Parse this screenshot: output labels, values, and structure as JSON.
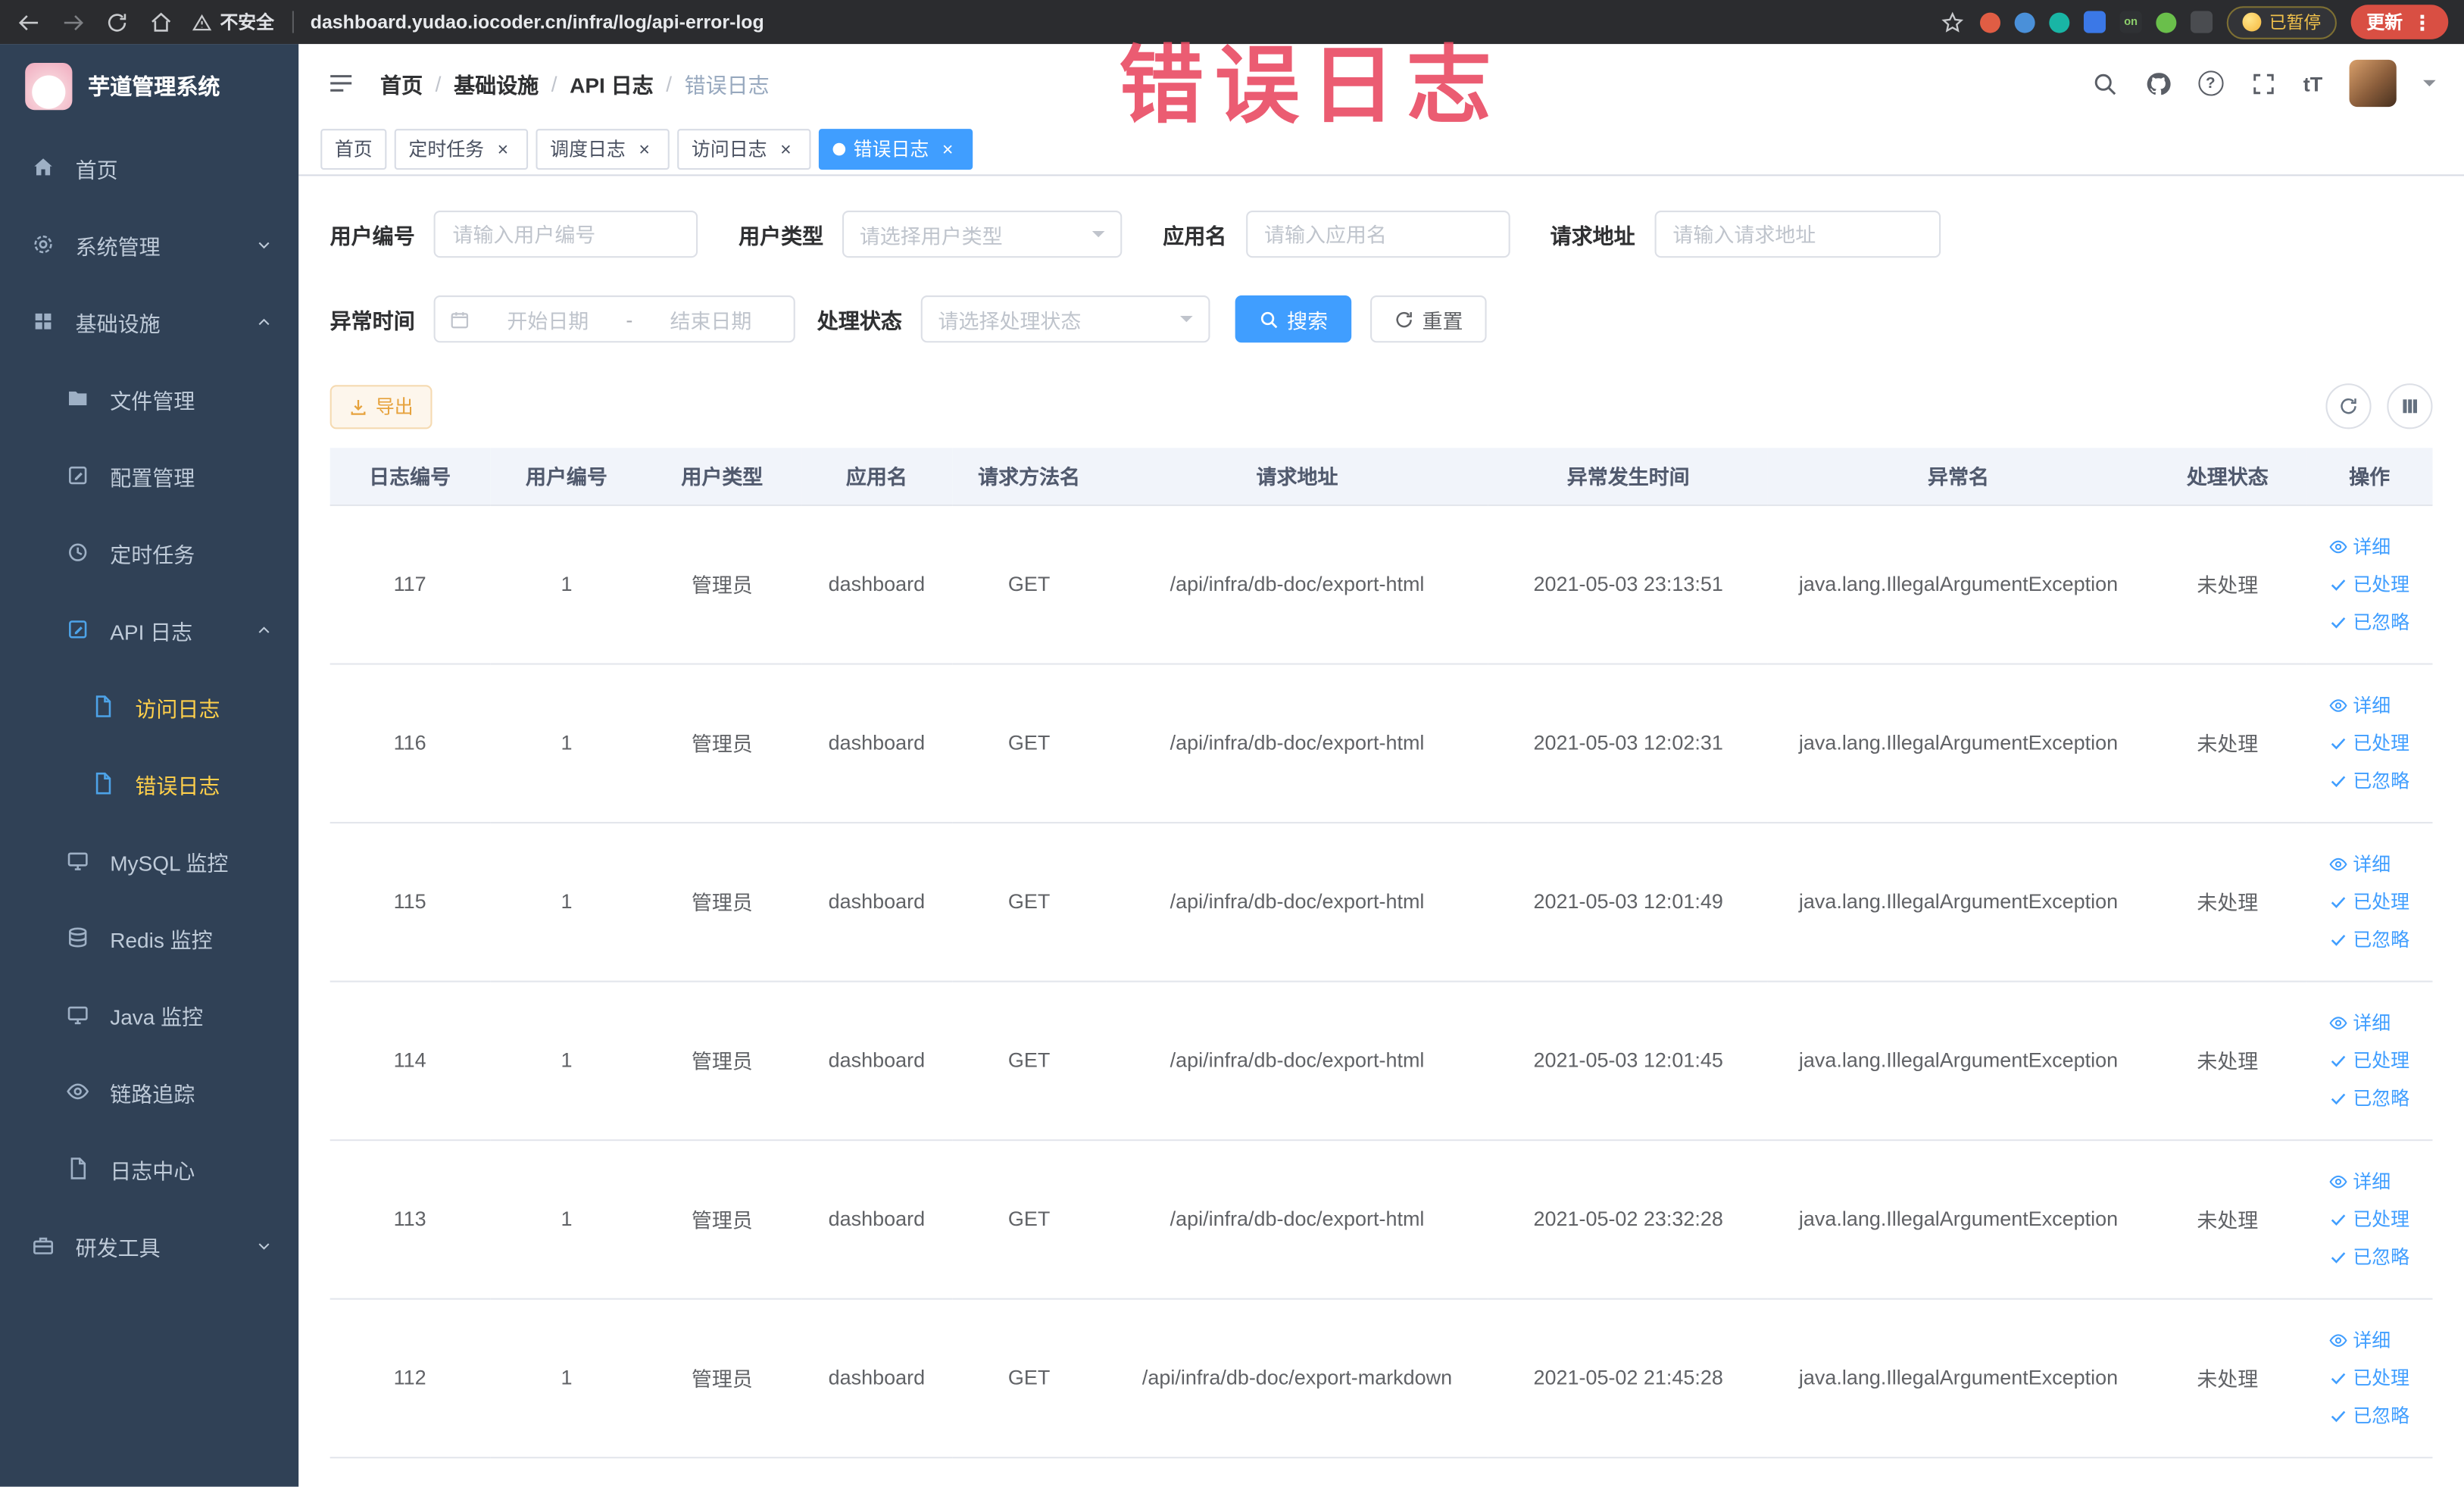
{
  "browser": {
    "security_label": "不安全",
    "url": "dashboard.yudao.iocoder.cn/infra/log/api-error-log",
    "extension_on_label": "on",
    "paused_badge": "已暂停",
    "update_label": "更新"
  },
  "annotation": {
    "text": "错误日志"
  },
  "sidebar": {
    "logo_title": "芋道管理系统",
    "home": "首页",
    "system": "系统管理",
    "infra": "基础设施",
    "devtools": "研发工具",
    "infra_items": [
      "文件管理",
      "配置管理",
      "定时任务",
      "API 日志",
      "MySQL 监控",
      "Redis 监控",
      "Java 监控",
      "链路追踪",
      "日志中心"
    ],
    "api_items": [
      "访问日志",
      "错误日志"
    ]
  },
  "header": {
    "breadcrumb": [
      "首页",
      "基础设施",
      "API 日志",
      "错误日志"
    ],
    "help_label": "?",
    "font_size_label": "tT"
  },
  "tabs": {
    "items": [
      "首页",
      "定时任务",
      "调度日志",
      "访问日志",
      "错误日志"
    ]
  },
  "filters": {
    "user_id": {
      "label": "用户编号",
      "placeholder": "请输入用户编号"
    },
    "user_type": {
      "label": "用户类型",
      "placeholder": "请选择用户类型"
    },
    "app_name": {
      "label": "应用名",
      "placeholder": "请输入应用名"
    },
    "request_url": {
      "label": "请求地址",
      "placeholder": "请输入请求地址"
    },
    "exception_time": {
      "label": "异常时间",
      "start_placeholder": "开始日期",
      "separator": "-",
      "end_placeholder": "结束日期"
    },
    "process_status": {
      "label": "处理状态",
      "placeholder": "请选择处理状态"
    },
    "search_button": "搜索",
    "reset_button": "重置"
  },
  "toolbar": {
    "export_button": "导出"
  },
  "table": {
    "headers": [
      "日志编号",
      "用户编号",
      "用户类型",
      "应用名",
      "请求方法名",
      "请求地址",
      "异常发生时间",
      "异常名",
      "处理状态",
      "操作"
    ],
    "actions": {
      "detail": "详细",
      "processed": "已处理",
      "ignored": "已忽略"
    },
    "rows": [
      {
        "log_id": "117",
        "user_id": "1",
        "user_type": "管理员",
        "app_name": "dashboard",
        "method": "GET",
        "url": "/api/infra/db-doc/export-html",
        "time": "2021-05-03 23:13:51",
        "exception": "java.lang.IllegalArgumentException",
        "status": "未处理"
      },
      {
        "log_id": "116",
        "user_id": "1",
        "user_type": "管理员",
        "app_name": "dashboard",
        "method": "GET",
        "url": "/api/infra/db-doc/export-html",
        "time": "2021-05-03 12:02:31",
        "exception": "java.lang.IllegalArgumentException",
        "status": "未处理"
      },
      {
        "log_id": "115",
        "user_id": "1",
        "user_type": "管理员",
        "app_name": "dashboard",
        "method": "GET",
        "url": "/api/infra/db-doc/export-html",
        "time": "2021-05-03 12:01:49",
        "exception": "java.lang.IllegalArgumentException",
        "status": "未处理"
      },
      {
        "log_id": "114",
        "user_id": "1",
        "user_type": "管理员",
        "app_name": "dashboard",
        "method": "GET",
        "url": "/api/infra/db-doc/export-html",
        "time": "2021-05-03 12:01:45",
        "exception": "java.lang.IllegalArgumentException",
        "status": "未处理"
      },
      {
        "log_id": "113",
        "user_id": "1",
        "user_type": "管理员",
        "app_name": "dashboard",
        "method": "GET",
        "url": "/api/infra/db-doc/export-html",
        "time": "2021-05-02 23:32:28",
        "exception": "java.lang.IllegalArgumentException",
        "status": "未处理"
      },
      {
        "log_id": "112",
        "user_id": "1",
        "user_type": "管理员",
        "app_name": "dashboard",
        "method": "GET",
        "url": "/api/infra/db-doc/export-markdown",
        "time": "2021-05-02 21:45:28",
        "exception": "java.lang.IllegalArgumentException",
        "status": "未处理"
      }
    ]
  },
  "colors": {
    "accent": "#409eff",
    "warning": "#e6a23c",
    "annotation": "#e94b63",
    "sidebar_bg": "#304156",
    "active_menu_text": "#ffd04b"
  }
}
